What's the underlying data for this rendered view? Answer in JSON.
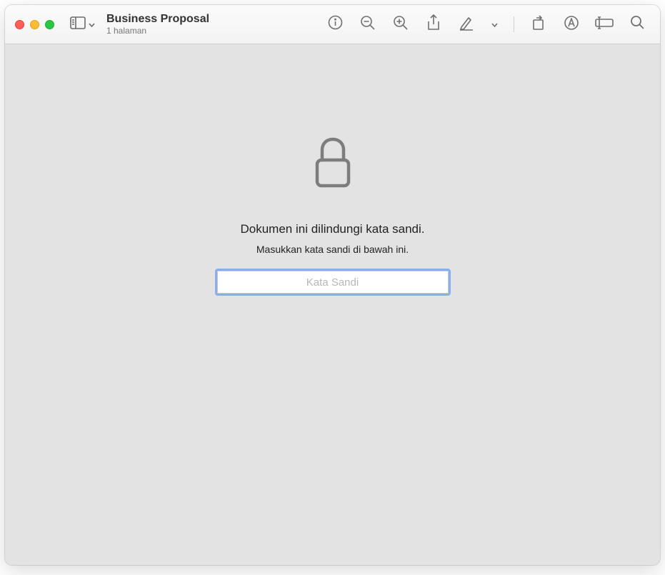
{
  "document": {
    "title": "Business Proposal",
    "subtitle": "1 halaman"
  },
  "lock": {
    "heading": "Dokumen ini dilindungi kata sandi.",
    "subheading": "Masukkan kata sandi di bawah ini.",
    "placeholder": "Kata Sandi"
  }
}
